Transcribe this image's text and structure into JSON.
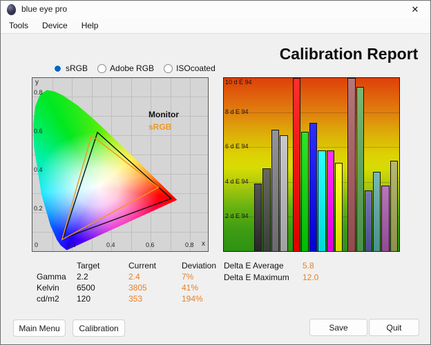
{
  "window": {
    "title": "blue eye pro"
  },
  "icons": {
    "close": "✕",
    "app": "eye-icon"
  },
  "menu": {
    "items": [
      {
        "label": "Tools"
      },
      {
        "label": "Device"
      },
      {
        "label": "Help"
      }
    ]
  },
  "profiles": {
    "options": [
      {
        "label": "sRGB",
        "selected": true
      },
      {
        "label": "Adobe RGB",
        "selected": false
      },
      {
        "label": "ISOcoated",
        "selected": false
      }
    ]
  },
  "report": {
    "title": "Calibration Report"
  },
  "chart_data": [
    {
      "type": "bar",
      "title": "Delta E 94 per test patch",
      "categories": [
        "black",
        "dark gray",
        "gray",
        "light gray",
        "red",
        "green",
        "blue",
        "cyan",
        "magenta",
        "yellow",
        "dark red",
        "dark green",
        "dark blue",
        "dark cyan",
        "dark magenta",
        "dark yellow"
      ],
      "values": [
        3.9,
        4.8,
        7.0,
        6.7,
        12.0,
        6.9,
        7.4,
        5.8,
        5.8,
        5.1,
        10.8,
        9.5,
        3.5,
        4.6,
        3.8,
        5.2
      ],
      "bar_colors": [
        "#2e2e2e",
        "#474747",
        "#7d7d7d",
        "#bdbdbd",
        "#ff0000",
        "#00dc00",
        "#0000ff",
        "#00ffff",
        "#ff00ff",
        "#ffff00",
        "#a85959",
        "#59a859",
        "#5959a8",
        "#59a8a8",
        "#a859a8",
        "#a8a859"
      ],
      "groups": [
        4,
        6,
        6
      ],
      "ylim": [
        0,
        10
      ],
      "bars_clipped_at_top": true,
      "axis_labels": [
        {
          "value": 10,
          "label": "10 d E 94"
        },
        {
          "value": 8,
          "label": "8 d E 94"
        },
        {
          "value": 6,
          "label": "6 d E 94"
        },
        {
          "value": 4,
          "label": "4 d E 94"
        },
        {
          "value": 2,
          "label": "2 d E 94"
        }
      ],
      "background": "green-to-red risk gradient",
      "legend_position": "none",
      "grid": true
    },
    {
      "type": "chromaticity-diagram",
      "title": "CIE xy gamut comparison",
      "xlabel": "x",
      "ylabel": "y",
      "x_ticks": [
        "0",
        "0.2",
        "0.4",
        "0.6",
        "0.8"
      ],
      "y_ticks": [
        "0.8",
        "0.6",
        "0.4",
        "0.2"
      ],
      "grid_step": 0.1,
      "legend": [
        {
          "label": "Monitor",
          "color": "#111111"
        },
        {
          "label": "sRGB",
          "color": "#f0981e"
        }
      ],
      "monitor_primaries": {
        "red": [
          0.705,
          0.272
        ],
        "green": [
          0.33,
          0.615
        ],
        "blue": [
          0.155,
          0.065
        ]
      },
      "srgb_primaries": {
        "red": [
          0.64,
          0.33
        ],
        "green": [
          0.3,
          0.6
        ],
        "blue": [
          0.15,
          0.06
        ]
      }
    }
  ],
  "results": {
    "headers": [
      "Target",
      "Current",
      "Deviation"
    ],
    "rows": [
      {
        "label": "Gamma",
        "target": "2.2",
        "current": "2.4",
        "deviation": "7%"
      },
      {
        "label": "Kelvin",
        "target": "6500",
        "current": "3805",
        "deviation": "41%"
      },
      {
        "label": "cd/m2",
        "target": "120",
        "current": "353",
        "deviation": "194%"
      }
    ]
  },
  "delta": {
    "rows": [
      {
        "label": "Delta E Average",
        "value": "5.8"
      },
      {
        "label": "Delta E Maximum",
        "value": "12.0"
      }
    ]
  },
  "buttons": {
    "main_menu": "Main Menu",
    "calibration": "Calibration",
    "save": "Save",
    "quit": "Quit"
  },
  "colors": {
    "value_orange": "#e87f25",
    "radio_selected_blue": "#0067c0",
    "srgb_triangle_orange": "#f0981e",
    "monitor_triangle_black": "#111111"
  }
}
